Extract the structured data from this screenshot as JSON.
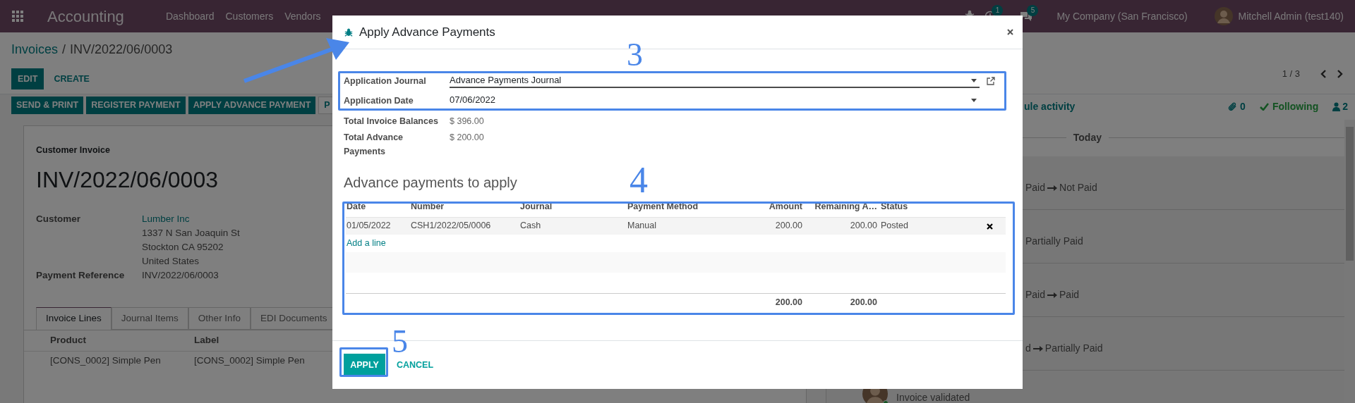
{
  "navbar": {
    "app_title": "Accounting",
    "menu": [
      "Dashboard",
      "Customers",
      "Vendors"
    ],
    "notifications": [
      {
        "kind": "activity",
        "count": "1"
      },
      {
        "kind": "messages",
        "count": "5"
      }
    ],
    "company": "My Company (San Francisco)",
    "user": "Mitchell Admin (test140)"
  },
  "breadcrumb": {
    "parent": "Invoices",
    "separator": "/",
    "current": "INV/2022/06/0003"
  },
  "control_buttons": [
    {
      "label": "EDIT",
      "kind": "primary"
    },
    {
      "label": "CREATE",
      "kind": "link"
    }
  ],
  "pager": "1 / 3",
  "action_buttons": [
    {
      "label": "SEND & PRINT",
      "kind": "primary"
    },
    {
      "label": "REGISTER PAYMENT",
      "kind": "primary"
    },
    {
      "label": "APPLY ADVANCE PAYMENT",
      "kind": "primary"
    },
    {
      "label": "P",
      "kind": "secondary"
    }
  ],
  "form": {
    "subtitle": "Customer Invoice",
    "name": "INV/2022/06/0003",
    "fields": [
      {
        "label": "Customer",
        "link": "Lumber Inc",
        "address": [
          "1337 N San Joaquin St",
          "Stockton CA 95202",
          "United States"
        ]
      },
      {
        "label": "Payment Reference",
        "value": "INV/2022/06/0003"
      }
    ],
    "tabs": [
      {
        "label": "Invoice Lines",
        "selected": true
      },
      {
        "label": "Journal Items",
        "selected": false
      },
      {
        "label": "Other Info",
        "selected": false
      },
      {
        "label": "EDI Documents",
        "selected": false
      }
    ],
    "columns": [
      "Product",
      "Label"
    ],
    "rows": [
      [
        "[CONS_0002] Simple Pen",
        "[CONS_0002] Simple Pen"
      ]
    ]
  },
  "chatter": {
    "activity_link": "ule activity",
    "attachments": "0",
    "follow": "Following",
    "followers": "2",
    "date_separator": "Today",
    "messages": [
      {
        "old": "Paid",
        "new": "Not Paid"
      },
      {
        "new": "Partially Paid"
      },
      {
        "old": "Paid",
        "new": "Paid"
      },
      {
        "old": "d",
        "new": "Partially Paid"
      }
    ],
    "last_message": "Invoice validated"
  },
  "dialog": {
    "title": "Apply Advance Payments",
    "fields": [
      {
        "label": "Application Journal",
        "value": "Advance Payments Journal",
        "focused": true,
        "external_link": true
      },
      {
        "label": "Application Date",
        "value": "07/06/2022",
        "focused": false,
        "external_link": false
      }
    ],
    "totals": [
      {
        "label": "Total Invoice Balances",
        "value": "$ 396.00"
      },
      {
        "label": "Total Advance Payments",
        "value": "$ 200.00"
      }
    ],
    "section_title": "Advance payments to apply",
    "table": {
      "columns": [
        {
          "label": "Date"
        },
        {
          "label": "Number"
        },
        {
          "label": "Journal"
        },
        {
          "label": "Payment Method"
        },
        {
          "label": "Amount",
          "total": "200.00"
        },
        {
          "label": "Remaining A…",
          "total": "200.00"
        },
        {
          "label": "Status"
        }
      ],
      "rows": [
        [
          "01/05/2022",
          "CSH1/2022/05/0006",
          "Cash",
          "Manual",
          "200.00",
          "200.00",
          "Posted"
        ]
      ],
      "add_line": "Add a line"
    },
    "buttons": [
      {
        "label": "APPLY",
        "kind": "primary"
      },
      {
        "label": "CANCEL",
        "kind": "link"
      }
    ]
  },
  "annotations": [
    {
      "label": "3"
    },
    {
      "label": "4"
    },
    {
      "label": "5"
    }
  ]
}
